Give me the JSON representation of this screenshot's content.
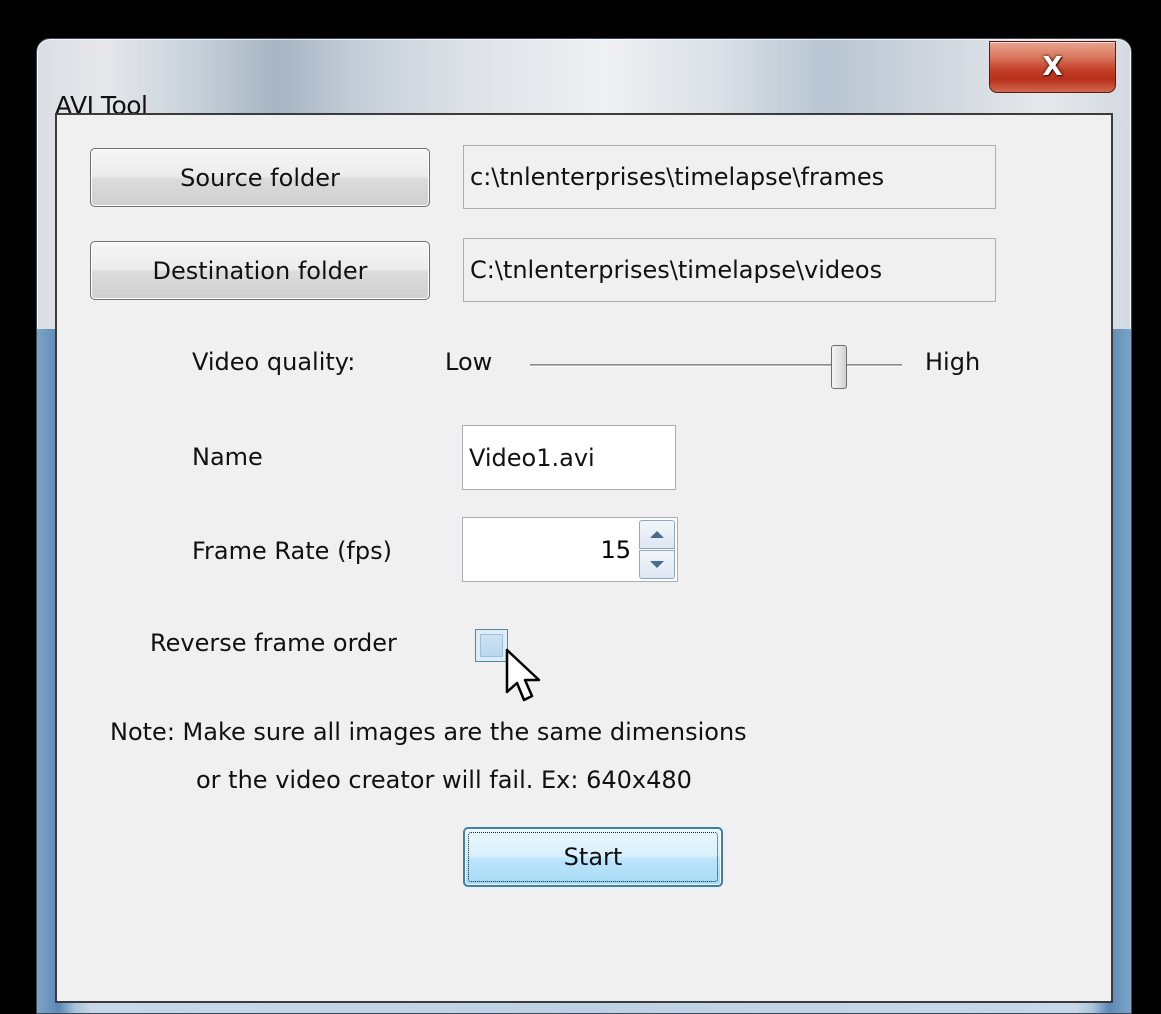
{
  "window": {
    "title": "AVI Tool",
    "close_label": "X"
  },
  "source": {
    "button_label": "Source folder",
    "path": "c:\\tnlenterprises\\timelapse\\frames"
  },
  "destination": {
    "button_label": "Destination folder",
    "path": "C:\\tnlenterprises\\timelapse\\videos"
  },
  "quality": {
    "label": "Video quality:",
    "low_label": "Low",
    "high_label": "High",
    "level": 0.83
  },
  "name": {
    "label": "Name",
    "value": "Video1.avi"
  },
  "frame_rate": {
    "label": "Frame Rate (fps)",
    "value": "15"
  },
  "reverse": {
    "label": "Reverse frame order",
    "checked": false
  },
  "note": {
    "line1": "Note: Make sure all images are the same dimensions",
    "line2": "or the video creator will fail. Ex: 640x480"
  },
  "start_label": "Start",
  "icons": {
    "close": "close-icon",
    "spin_up": "chevron-up-icon",
    "spin_down": "chevron-down-icon",
    "cursor": "mouse-pointer-icon"
  },
  "colors": {
    "close_button": "#c2402a",
    "client_bg": "#f0f0f0",
    "default_button_border": "#3c7fb1"
  }
}
